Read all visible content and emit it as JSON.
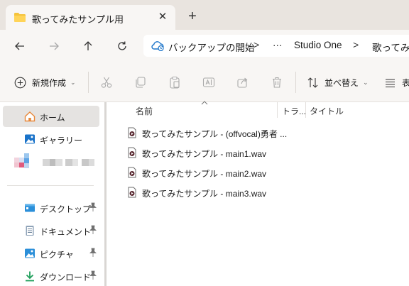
{
  "window": {
    "tab_title": "歌ってみたサンプル用",
    "close_glyph": "✕",
    "new_tab_glyph": "+"
  },
  "address": {
    "crumbs": [
      "バックアップの開始",
      "···",
      "Studio One",
      "歌ってみた"
    ],
    "separator": ">"
  },
  "toolbar": {
    "new_label": "新規作成",
    "sort_label": "並べ替え",
    "view_label": "表"
  },
  "sidebar": {
    "items": [
      {
        "label": "ホーム",
        "icon": "home-icon",
        "selected": true
      },
      {
        "label": "ギャラリー",
        "icon": "gallery-icon",
        "selected": false
      },
      {
        "label": "デスクトップ",
        "icon": "desktop-icon",
        "pinned": true
      },
      {
        "label": "ドキュメント",
        "icon": "document-icon",
        "pinned": true
      },
      {
        "label": "ピクチャ",
        "icon": "pictures-icon",
        "pinned": true
      },
      {
        "label": "ダウンロード",
        "icon": "download-icon",
        "pinned": true
      }
    ]
  },
  "columns": {
    "name": "名前",
    "track": "トラ...",
    "title": "タイトル"
  },
  "files": [
    {
      "name": "歌ってみたサンプル - (offvocal)勇者 ..."
    },
    {
      "name": "歌ってみたサンプル - main1.wav"
    },
    {
      "name": "歌ってみたサンプル - main2.wav"
    },
    {
      "name": "歌ってみたサンプル - main3.wav"
    }
  ],
  "colors": {
    "tabstrip_bg": "#e9e4df",
    "chrome_bg": "#f8f6f4",
    "folder_yellow": "#f5c33b",
    "accent_blue": "#1a73c9",
    "download_green": "#1e9e5a"
  }
}
